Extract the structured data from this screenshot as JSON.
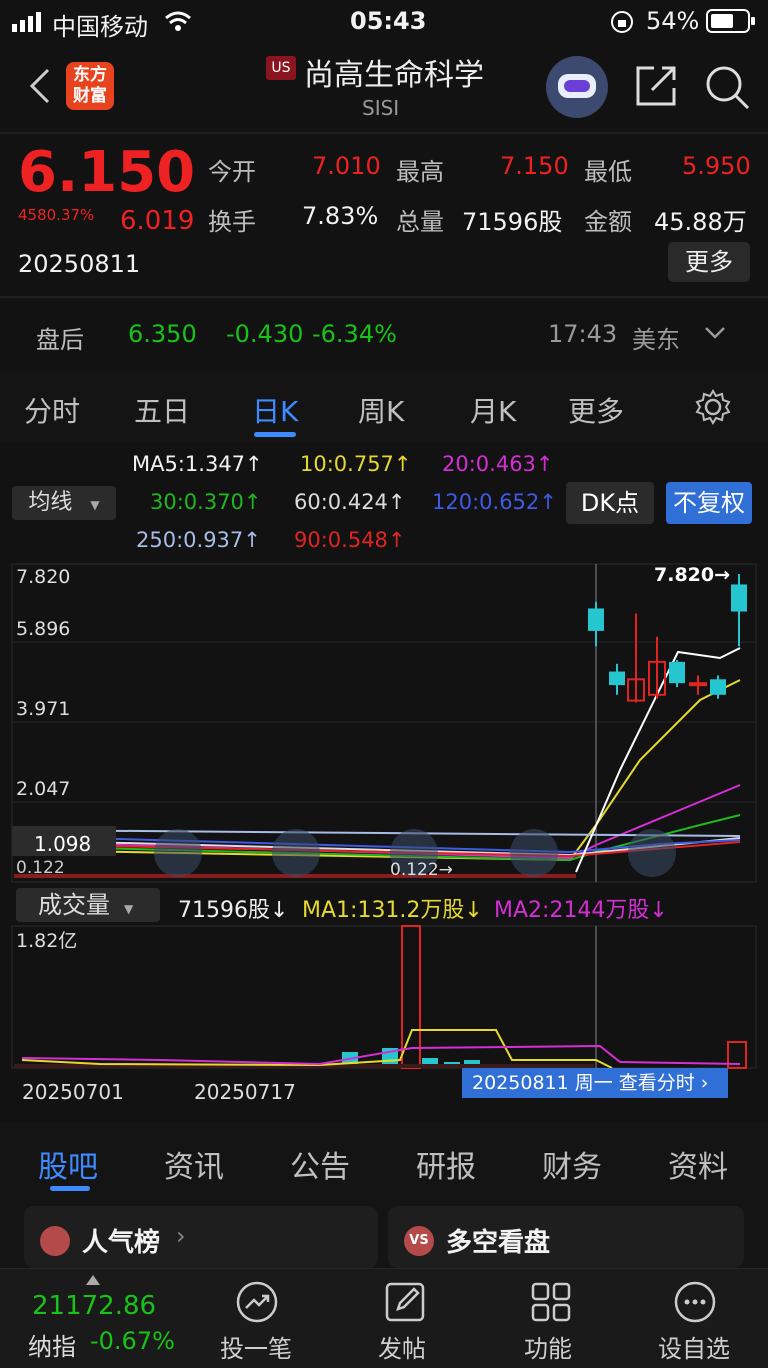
{
  "status_bar": {
    "carrier": "中国移动",
    "time": "05:43",
    "battery": "54%"
  },
  "header": {
    "logo_line1": "东方",
    "logo_line2": "财富",
    "market_badge": "US",
    "title": "尚高生命科学",
    "ticker": "SISI"
  },
  "quote": {
    "price": "6.150",
    "change_pct": "4580.37%",
    "change_val": "6.019",
    "date": "20250811",
    "open_label": "今开",
    "open": "7.010",
    "high_label": "最高",
    "high": "7.150",
    "low_label": "最低",
    "low": "5.950",
    "turnover_label": "换手",
    "turnover": "7.83%",
    "volume_label": "总量",
    "volume": "71596股",
    "amount_label": "金额",
    "amount": "45.88万",
    "more": "更多"
  },
  "after_hours": {
    "label": "盘后",
    "price": "6.350",
    "change": "-0.430",
    "pct": "-6.34%",
    "time": "17:43",
    "zone": "美东"
  },
  "tabs": [
    "分时",
    "五日",
    "日K",
    "周K",
    "月K",
    "更多"
  ],
  "ma": {
    "dropdown": "均线",
    "ma5": "MA5:1.347↑",
    "ma10": "10:0.757↑",
    "ma20": "20:0.463↑",
    "ma30": "30:0.370↑",
    "ma60": "60:0.424↑",
    "ma120": "120:0.652↑",
    "ma250": "250:0.937↑",
    "ma90": "90:0.548↑",
    "dk_button": "DK点",
    "fq_button": "不复权"
  },
  "chart_axis": {
    "y1": "7.820",
    "y2": "5.896",
    "y3": "3.971",
    "y4": "2.047",
    "y5": "0.122",
    "cursor": "1.098",
    "max_label": "7.820→",
    "min_label": "0.122→"
  },
  "volume": {
    "dropdown": "成交量",
    "vol": "71596股↓",
    "ma1": "MA1:131.2万股↓",
    "ma2": "MA2:2144万股↓",
    "max": "1.82亿"
  },
  "x_axis": {
    "d1": "20250701",
    "d2": "20250717",
    "tooltip": "20250811 周一 查看分时"
  },
  "section_tabs": [
    "股吧",
    "资讯",
    "公告",
    "研报",
    "财务",
    "资料"
  ],
  "cards": {
    "left": "人气榜",
    "right": "多空看盘"
  },
  "bottom": {
    "index_value": "21172.86",
    "index_name": "纳指",
    "index_pct": "-0.67%",
    "nav": [
      "投一笔",
      "发帖",
      "功能",
      "设自选"
    ]
  },
  "chart_data": {
    "type": "candlestick",
    "ylim": [
      0.122,
      7.82
    ],
    "candles": [
      {
        "o": 6.35,
        "c": 6.93,
        "h": 7.1,
        "l": 5.95,
        "color": "cyan"
      },
      {
        "o": 5.3,
        "c": 4.95,
        "h": 5.5,
        "l": 4.7,
        "color": "cyan"
      },
      {
        "o": 4.55,
        "c": 5.1,
        "h": 6.8,
        "l": 4.5,
        "color": "red"
      },
      {
        "o": 4.7,
        "c": 5.55,
        "h": 6.2,
        "l": 4.6,
        "color": "red"
      },
      {
        "o": 5.55,
        "c": 5.0,
        "h": 5.6,
        "l": 4.9,
        "color": "cyan"
      },
      {
        "o": 4.95,
        "c": 5.0,
        "h": 5.2,
        "l": 4.7,
        "color": "red"
      },
      {
        "o": 5.1,
        "c": 4.7,
        "h": 5.2,
        "l": 4.6,
        "color": "cyan"
      },
      {
        "o": 6.85,
        "c": 7.55,
        "h": 7.82,
        "l": 5.95,
        "color": "cyan"
      }
    ],
    "volume_max": "1.82亿"
  }
}
